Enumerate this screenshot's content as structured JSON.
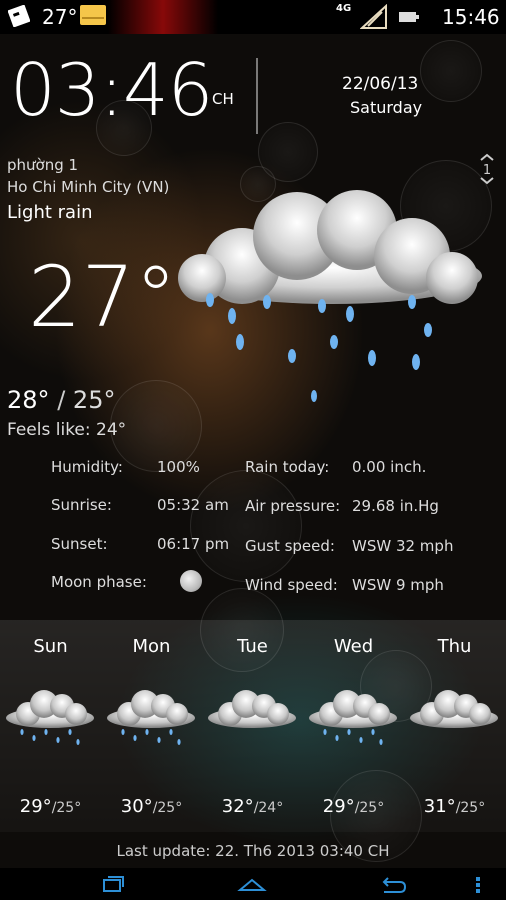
{
  "status_bar": {
    "weather_icon": "weather-cloud-icon",
    "temperature": "27°",
    "mail_icon": "mail-icon",
    "network_type": "4G",
    "signal_icon": "signal-icon",
    "battery_icon": "battery-icon",
    "time": "15:46"
  },
  "clock": {
    "time": "03:46",
    "ampm": "CH",
    "date": "22/06/13",
    "day": "Saturday"
  },
  "location": {
    "ward": "phường 1",
    "city": "Ho Chi Minh City (VN)"
  },
  "page_indicator": "1",
  "current": {
    "condition": "Light rain",
    "temperature": "27°",
    "high": "28°",
    "separator": "/",
    "low": "25°",
    "feels_like": "Feels like: 24°",
    "icon": "rain-cloud-icon"
  },
  "details": {
    "humidity_label": "Humidity:",
    "humidity_value": "100%",
    "sunrise_label": "Sunrise:",
    "sunrise_value": "05:32 am",
    "sunset_label": "Sunset:",
    "sunset_value": "06:17 pm",
    "moon_label": "Moon phase:",
    "moon_icon": "full-moon-icon",
    "rain_label": "Rain today:",
    "rain_value": "0.00 inch.",
    "pressure_label": "Air pressure:",
    "pressure_value": "29.68 in.Hg",
    "gust_label": "Gust speed:",
    "gust_value": "WSW 32 mph",
    "wind_label": "Wind speed:",
    "wind_value": "WSW 9 mph"
  },
  "forecast": [
    {
      "day": "Sun",
      "high": "29°",
      "low": "/25°",
      "icon": "rain-cloud-icon"
    },
    {
      "day": "Mon",
      "high": "30°",
      "low": "/25°",
      "icon": "rain-cloud-icon"
    },
    {
      "day": "Tue",
      "high": "32°",
      "low": "/24°",
      "icon": "cloud-icon"
    },
    {
      "day": "Wed",
      "high": "29°",
      "low": "/25°",
      "icon": "rain-cloud-icon"
    },
    {
      "day": "Thu",
      "high": "31°",
      "low": "/25°",
      "icon": "cloud-icon"
    }
  ],
  "last_update": "Last update: 22. Th6 2013  03:40 CH",
  "nav": {
    "recent_icon": "recent-apps-icon",
    "home_icon": "home-icon",
    "back_icon": "back-icon",
    "menu_icon": "menu-icon"
  },
  "colors": {
    "background": "#0e0c0a",
    "nav_icon": "#2d8fd6",
    "rain_drop": "#6fb3f0"
  }
}
